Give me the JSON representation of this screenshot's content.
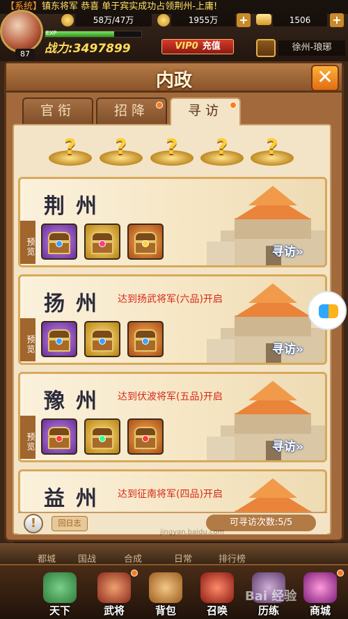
{
  "topbar": {
    "marquee_system": "【系统】",
    "marquee_text": "镇东将军 恭喜 单于宾实成功占领荆州-上庸!",
    "troops": "58万/47万",
    "copper": "1955万",
    "gold": "1506",
    "exp_label": "EXP",
    "exp_fill": 0.72,
    "power": "战力:3497899",
    "level": "87",
    "vip": "VIP0",
    "recharge": "充值",
    "location": "徐州-琅琊"
  },
  "panel": {
    "title": "内政",
    "close_label": "✕",
    "tabs": [
      {
        "label": "官衔",
        "active": false,
        "dot": false
      },
      {
        "label": "招降",
        "active": false,
        "dot": true
      },
      {
        "label": "寻访",
        "active": true,
        "dot": true
      }
    ],
    "mystery_slot": "?",
    "cards": [
      {
        "name": "荆州",
        "req": "",
        "preview": "预览",
        "visit": "寻访»"
      },
      {
        "name": "扬州",
        "req": "达到扬武将军(六品)开启",
        "preview": "预览",
        "visit": "寻访»"
      },
      {
        "name": "豫州",
        "req": "达到伏波将军(五品)开启",
        "preview": "预览",
        "visit": "寻访»"
      },
      {
        "name": "益州",
        "req": "达到征南将军(四品)开启",
        "preview": "",
        "visit": ""
      }
    ],
    "footer": {
      "info": "!",
      "log": "回日志",
      "count": "可寻访次数:5/5"
    }
  },
  "bg_tabs": [
    "都城",
    "国战",
    "合成",
    "日常",
    "排行榜"
  ],
  "bottom_nav": [
    {
      "label": "天下",
      "color": "#3aa15a"
    },
    {
      "label": "武将",
      "color": "#c9522a"
    },
    {
      "label": "背包",
      "color": "#c98a3a"
    },
    {
      "label": "召唤",
      "color": "#b8322a"
    },
    {
      "label": "历练",
      "color": "#8a6a9a"
    },
    {
      "label": "商城",
      "color": "#9a3a9a"
    }
  ],
  "watermark": "Bai 经验",
  "watermark_url": "jingyan.baidu.com"
}
